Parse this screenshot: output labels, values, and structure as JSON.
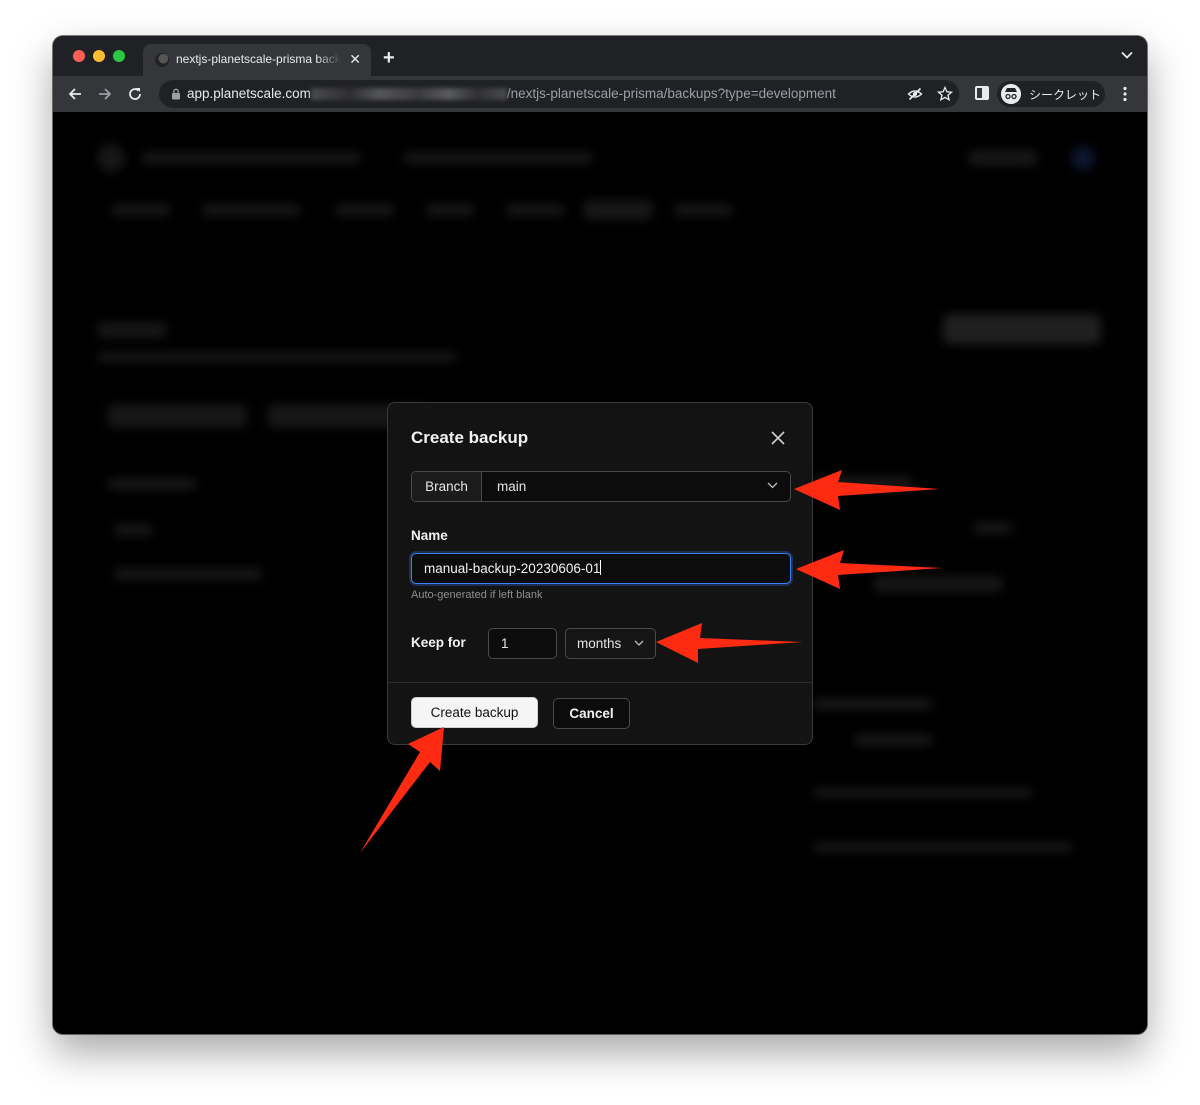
{
  "browser": {
    "tab_title": "nextjs-planetscale-prisma backups",
    "url_host": "app.planetscale.com",
    "url_path": "/nextjs-planetscale-prisma/backups?type=development",
    "profile_label": "シークレット"
  },
  "modal": {
    "title": "Create backup",
    "branch_label": "Branch",
    "branch_value": "main",
    "name_label": "Name",
    "name_value": "manual-backup-20230606-01",
    "name_hint": "Auto-generated if left blank",
    "keep_for_label": "Keep for",
    "keep_for_value": "1",
    "keep_for_unit": "months",
    "create_button": "Create backup",
    "cancel_button": "Cancel"
  },
  "annotation_color": "#ff2a12",
  "accent_color": "#3b82f6"
}
